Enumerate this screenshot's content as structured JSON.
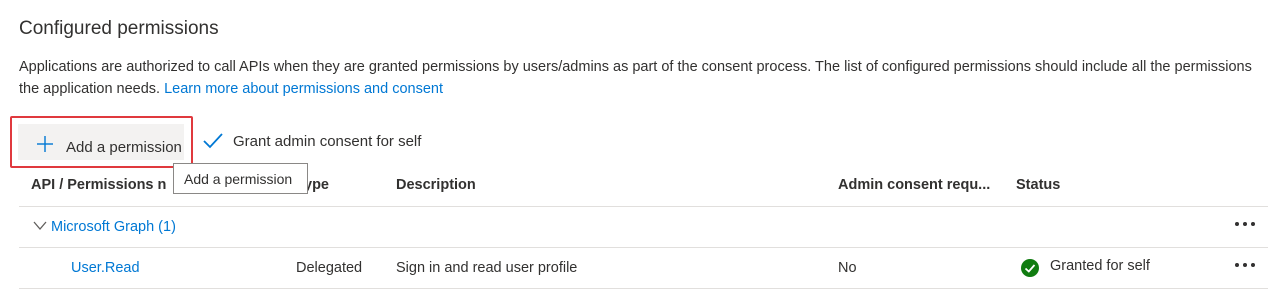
{
  "section": {
    "title": "Configured permissions",
    "description": "Applications are authorized to call APIs when they are granted permissions by users/admins as part of the consent process. The list of configured permissions should include all the permissions the application needs.",
    "learn_more_link": "Learn more about permissions and consent"
  },
  "toolbar": {
    "add_permission_label": "Add a permission",
    "grant_consent_label": "Grant admin consent for self"
  },
  "tooltip": {
    "text": "Add a permission"
  },
  "table": {
    "headers": {
      "api": "API / Permissions n",
      "type": "ype",
      "description": "Description",
      "admin_consent": "Admin consent requ...",
      "status": "Status"
    },
    "groups": [
      {
        "name": "Microsoft Graph (1)",
        "rows": [
          {
            "name": "User.Read",
            "type": "Delegated",
            "description": "Sign in and read user profile",
            "admin_consent": "No",
            "status": "Granted for self"
          }
        ]
      }
    ]
  },
  "colors": {
    "accent": "#0078d4",
    "highlight_border": "#e0393e",
    "status_success": "#107c10"
  }
}
